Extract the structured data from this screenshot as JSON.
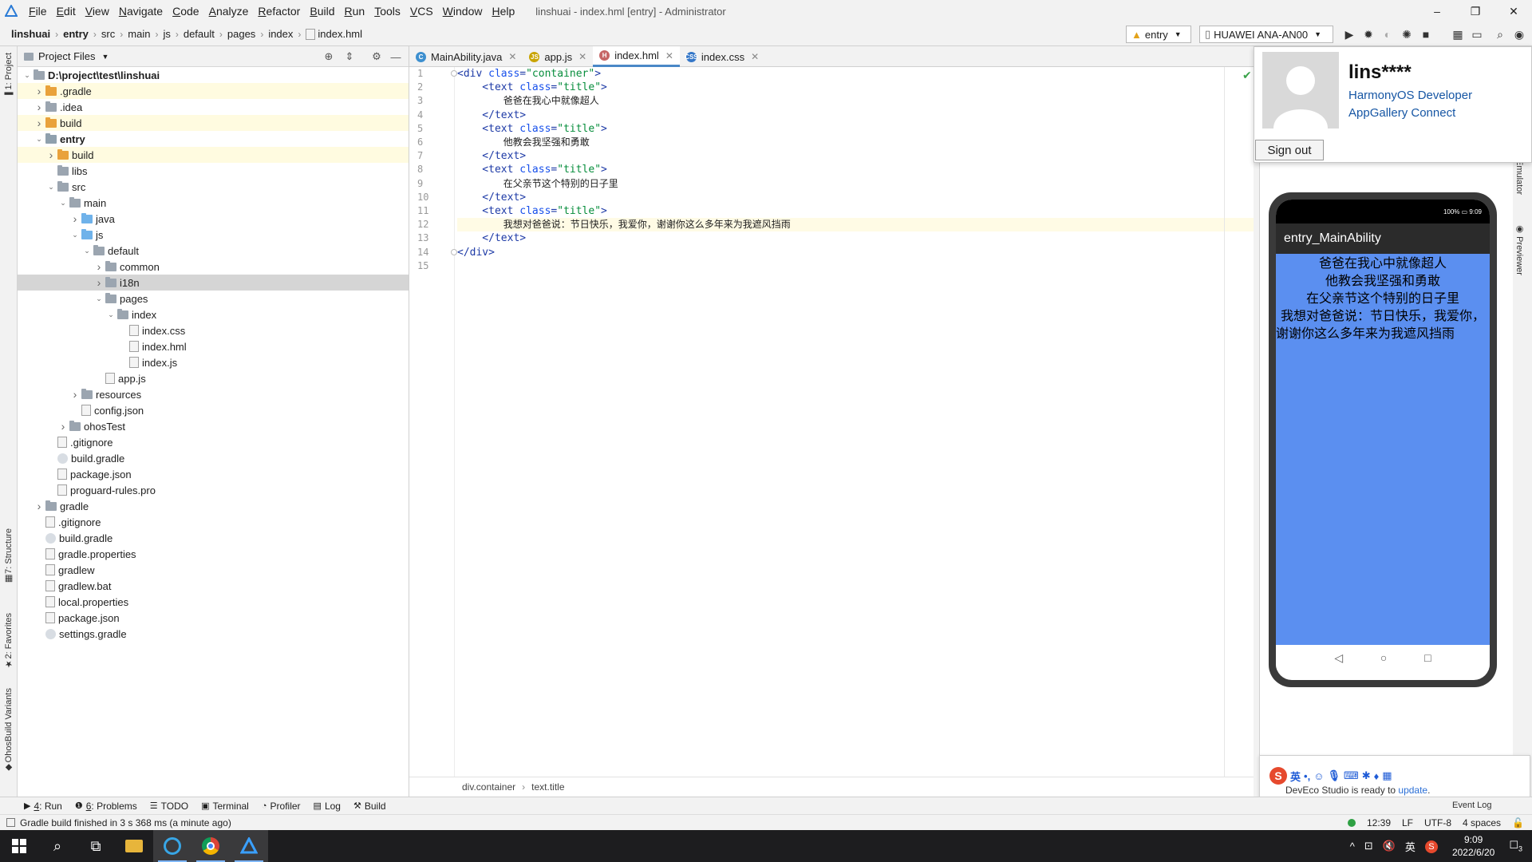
{
  "menubar": {
    "items": [
      "File",
      "Edit",
      "View",
      "Navigate",
      "Code",
      "Analyze",
      "Refactor",
      "Build",
      "Run",
      "Tools",
      "VCS",
      "Window",
      "Help"
    ],
    "window_title": "linshuai - index.hml [entry] - Administrator",
    "controls": [
      "–",
      "❐",
      "✕"
    ]
  },
  "navbar": {
    "crumbs": [
      "linshuai",
      "entry",
      "src",
      "main",
      "js",
      "default",
      "pages",
      "index",
      "index.hml"
    ],
    "run_config": "entry",
    "device": "HUAWEI ANA-AN00"
  },
  "left_strip": {
    "project": "1: Project",
    "structure": "7: Structure",
    "favorites": "2: Favorites",
    "variants": "OhosBuild Variants"
  },
  "right_strip": {
    "emulator": "Emulator",
    "previewer": "Previewer"
  },
  "project_panel": {
    "title": "Project Files",
    "tree": [
      {
        "label": "D:\\project\\test\\linshuai",
        "depth": 0,
        "twisty": "open",
        "icon": "folder-gray",
        "bold": true
      },
      {
        "label": ".gradle",
        "depth": 1,
        "twisty": "closed",
        "icon": "folder-orange",
        "hl": true
      },
      {
        "label": ".idea",
        "depth": 1,
        "twisty": "closed",
        "icon": "folder-gray"
      },
      {
        "label": "build",
        "depth": 1,
        "twisty": "closed",
        "icon": "folder-orange",
        "hl": true
      },
      {
        "label": "entry",
        "depth": 1,
        "twisty": "open",
        "icon": "folder-entry",
        "bold": true
      },
      {
        "label": "build",
        "depth": 2,
        "twisty": "closed",
        "icon": "folder-orange",
        "hl": true
      },
      {
        "label": "libs",
        "depth": 2,
        "twisty": "none",
        "icon": "folder-gray"
      },
      {
        "label": "src",
        "depth": 2,
        "twisty": "open",
        "icon": "folder-gray"
      },
      {
        "label": "main",
        "depth": 3,
        "twisty": "open",
        "icon": "folder-gray"
      },
      {
        "label": "java",
        "depth": 4,
        "twisty": "closed",
        "icon": "folder-blue"
      },
      {
        "label": "js",
        "depth": 4,
        "twisty": "open",
        "icon": "folder-blue"
      },
      {
        "label": "default",
        "depth": 5,
        "twisty": "open",
        "icon": "folder-gray"
      },
      {
        "label": "common",
        "depth": 6,
        "twisty": "closed",
        "icon": "folder-gray"
      },
      {
        "label": "i18n",
        "depth": 6,
        "twisty": "closed",
        "icon": "folder-gray",
        "sel": true
      },
      {
        "label": "pages",
        "depth": 6,
        "twisty": "open",
        "icon": "folder-gray"
      },
      {
        "label": "index",
        "depth": 7,
        "twisty": "open",
        "icon": "folder-gray"
      },
      {
        "label": "index.css",
        "depth": 8,
        "twisty": "none",
        "icon": "file-css"
      },
      {
        "label": "index.hml",
        "depth": 8,
        "twisty": "none",
        "icon": "file-hml"
      },
      {
        "label": "index.js",
        "depth": 8,
        "twisty": "none",
        "icon": "file-js"
      },
      {
        "label": "app.js",
        "depth": 6,
        "twisty": "none",
        "icon": "file-js"
      },
      {
        "label": "resources",
        "depth": 4,
        "twisty": "closed",
        "icon": "folder-gray"
      },
      {
        "label": "config.json",
        "depth": 4,
        "twisty": "none",
        "icon": "file-json"
      },
      {
        "label": "ohosTest",
        "depth": 3,
        "twisty": "closed",
        "icon": "folder-gray"
      },
      {
        "label": ".gitignore",
        "depth": 2,
        "twisty": "none",
        "icon": "file-json"
      },
      {
        "label": "build.gradle",
        "depth": 2,
        "twisty": "none",
        "icon": "file-gradle"
      },
      {
        "label": "package.json",
        "depth": 2,
        "twisty": "none",
        "icon": "file-json"
      },
      {
        "label": "proguard-rules.pro",
        "depth": 2,
        "twisty": "none",
        "icon": "file-json"
      },
      {
        "label": "gradle",
        "depth": 1,
        "twisty": "closed",
        "icon": "folder-gray"
      },
      {
        "label": ".gitignore",
        "depth": 1,
        "twisty": "none",
        "icon": "file-json"
      },
      {
        "label": "build.gradle",
        "depth": 1,
        "twisty": "none",
        "icon": "file-gradle"
      },
      {
        "label": "gradle.properties",
        "depth": 1,
        "twisty": "none",
        "icon": "file-json"
      },
      {
        "label": "gradlew",
        "depth": 1,
        "twisty": "none",
        "icon": "file-json"
      },
      {
        "label": "gradlew.bat",
        "depth": 1,
        "twisty": "none",
        "icon": "file-json"
      },
      {
        "label": "local.properties",
        "depth": 1,
        "twisty": "none",
        "icon": "file-json"
      },
      {
        "label": "package.json",
        "depth": 1,
        "twisty": "none",
        "icon": "file-json"
      },
      {
        "label": "settings.gradle",
        "depth": 1,
        "twisty": "none",
        "icon": "file-gradle"
      }
    ]
  },
  "editor": {
    "tabs": [
      {
        "label": "MainAbility.java",
        "icon": "C",
        "color": "#3d8fcf",
        "active": false
      },
      {
        "label": "app.js",
        "icon": "JS",
        "color": "#c9a400",
        "active": false
      },
      {
        "label": "index.hml",
        "icon": "H",
        "color": "#c66666",
        "active": true
      },
      {
        "label": "index.css",
        "icon": "CSS",
        "color": "#3577c8",
        "active": false
      }
    ],
    "lines": [
      [
        {
          "t": "<div ",
          "c": "tag"
        },
        {
          "t": "class",
          "c": "attr"
        },
        {
          "t": "=",
          "c": "tag"
        },
        {
          "t": "\"container\"",
          "c": "str"
        },
        {
          "t": ">",
          "c": "tag"
        }
      ],
      [
        {
          "t": "    <text ",
          "c": "tag"
        },
        {
          "t": "class",
          "c": "attr"
        },
        {
          "t": "=",
          "c": "tag"
        },
        {
          "t": "\"title\"",
          "c": "str"
        },
        {
          "t": ">",
          "c": "tag"
        }
      ],
      [
        {
          "t": "        爸爸在我心中就像超人",
          "c": "txt"
        }
      ],
      [
        {
          "t": "    </text>",
          "c": "tag"
        }
      ],
      [
        {
          "t": "    <text ",
          "c": "tag"
        },
        {
          "t": "class",
          "c": "attr"
        },
        {
          "t": "=",
          "c": "tag"
        },
        {
          "t": "\"title\"",
          "c": "str"
        },
        {
          "t": ">",
          "c": "tag"
        }
      ],
      [
        {
          "t": "        他教会我坚强和勇敢",
          "c": "txt"
        }
      ],
      [
        {
          "t": "    </text>",
          "c": "tag"
        }
      ],
      [
        {
          "t": "    <text ",
          "c": "tag"
        },
        {
          "t": "class",
          "c": "attr"
        },
        {
          "t": "=",
          "c": "tag"
        },
        {
          "t": "\"title\"",
          "c": "str"
        },
        {
          "t": ">",
          "c": "tag"
        }
      ],
      [
        {
          "t": "        在父亲节这个特别的日子里",
          "c": "txt"
        }
      ],
      [
        {
          "t": "    </text>",
          "c": "tag"
        }
      ],
      [
        {
          "t": "    <text ",
          "c": "tag"
        },
        {
          "t": "class",
          "c": "attr"
        },
        {
          "t": "=",
          "c": "tag"
        },
        {
          "t": "\"title\"",
          "c": "str"
        },
        {
          "t": ">",
          "c": "tag"
        }
      ],
      [
        {
          "t": "        我想对爸爸说：节日快乐，我爱你，谢谢你这么多年来为我遮风挡雨",
          "c": "txt"
        }
      ],
      [
        {
          "t": "    </text>",
          "c": "tag"
        }
      ],
      [
        {
          "t": "</div>",
          "c": "tag"
        }
      ],
      []
    ],
    "current_line": 12,
    "breadcrumb": [
      "div.container",
      "text.title"
    ]
  },
  "previewer": {
    "app_title": "entry_MainAbility",
    "status_right": "100% ▭ 9:09",
    "lines": [
      "爸爸在我心中就像超人",
      "他教会我坚强和勇敢",
      "在父亲节这个特别的日子里",
      "我想对爸爸说：节日快乐，我爱你，",
      "谢谢你这么多年来为我遮风挡雨"
    ],
    "background": "#5b8ff0"
  },
  "account": {
    "name": "lins****",
    "links": [
      "HarmonyOS Developer",
      "AppGallery Connect"
    ],
    "sign_out": "Sign out"
  },
  "notification": {
    "ime": "英",
    "message": "DevEco Studio is ready to ",
    "link": "update",
    "tail": "."
  },
  "bottom_tools": [
    {
      "icon": "▶",
      "num": "4",
      "label": ": Run"
    },
    {
      "icon": "❶",
      "num": "6",
      "label": ": Problems"
    },
    {
      "icon": "☰",
      "num": "",
      "label": "TODO"
    },
    {
      "icon": "▣",
      "num": "",
      "label": "Terminal"
    },
    {
      "icon": "◔",
      "num": "",
      "label": "Profiler"
    },
    {
      "icon": "▤",
      "num": "",
      "label": "Log"
    },
    {
      "icon": "⚒",
      "num": "",
      "label": "Build"
    }
  ],
  "event_log": "Event Log",
  "status": {
    "message": "Gradle build finished in 3 s 368 ms (a minute ago)",
    "position": "12:39",
    "line_sep": "LF",
    "encoding": "UTF-8",
    "indent": "4 spaces"
  },
  "taskbar": {
    "time": "9:09",
    "date": "2022/6/20",
    "tray": [
      "^",
      "⊡",
      "🔇",
      "英"
    ],
    "notif_count": "3"
  }
}
